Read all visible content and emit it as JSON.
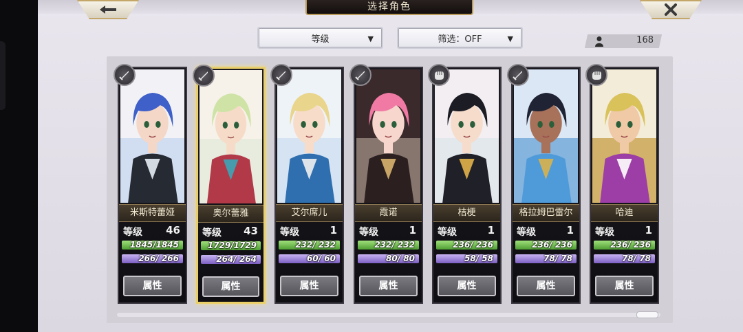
{
  "header": {
    "title": "选择角色",
    "back_icon": "arrow-left-icon",
    "close_icon": "close-icon"
  },
  "toolbar": {
    "sort_label": "等级",
    "filter_label": "筛选：OFF"
  },
  "roster": {
    "count": "168",
    "icon": "person-icon"
  },
  "colors": {
    "selected_border": "#e9cf6a",
    "hp_bar": "#6fbf4a",
    "mp_bar": "#9a7fd6"
  },
  "characters": [
    {
      "name": "米斯特蕾娅",
      "level_label": "等级",
      "level": "46",
      "hp": "1845/1845",
      "mp": "266/ 266",
      "hp_fill": 1,
      "mp_fill": 1,
      "button": "属性",
      "class_icon": "sword-icon",
      "selected": false
    },
    {
      "name": "奥尔蕾雅",
      "level_label": "等级",
      "level": "43",
      "hp": "1729/1729",
      "mp": "264/ 264",
      "hp_fill": 1,
      "mp_fill": 1,
      "button": "属性",
      "class_icon": "sword-icon",
      "selected": true
    },
    {
      "name": "艾尔席儿",
      "level_label": "等级",
      "level": "1",
      "hp": "232/ 232",
      "mp": "60/ 60",
      "hp_fill": 1,
      "mp_fill": 1,
      "button": "属性",
      "class_icon": "sword-icon",
      "selected": false
    },
    {
      "name": "霞诺",
      "level_label": "等级",
      "level": "1",
      "hp": "232/ 232",
      "mp": "80/ 80",
      "hp_fill": 1,
      "mp_fill": 1,
      "button": "属性",
      "class_icon": "sword-icon",
      "selected": false
    },
    {
      "name": "桔梗",
      "level_label": "等级",
      "level": "1",
      "hp": "236/ 236",
      "mp": "58/ 58",
      "hp_fill": 1,
      "mp_fill": 1,
      "button": "属性",
      "class_icon": "fist-icon",
      "selected": false
    },
    {
      "name": "格拉姆巴雷尔",
      "level_label": "等级",
      "level": "1",
      "hp": "236/ 236",
      "mp": "78/ 78",
      "hp_fill": 1,
      "mp_fill": 1,
      "button": "属性",
      "class_icon": "sword-icon",
      "selected": false
    },
    {
      "name": "哈迪",
      "level_label": "等级",
      "level": "1",
      "hp": "236/ 236",
      "mp": "78/ 78",
      "hp_fill": 1,
      "mp_fill": 1,
      "button": "属性",
      "class_icon": "fist-icon",
      "selected": false
    }
  ]
}
